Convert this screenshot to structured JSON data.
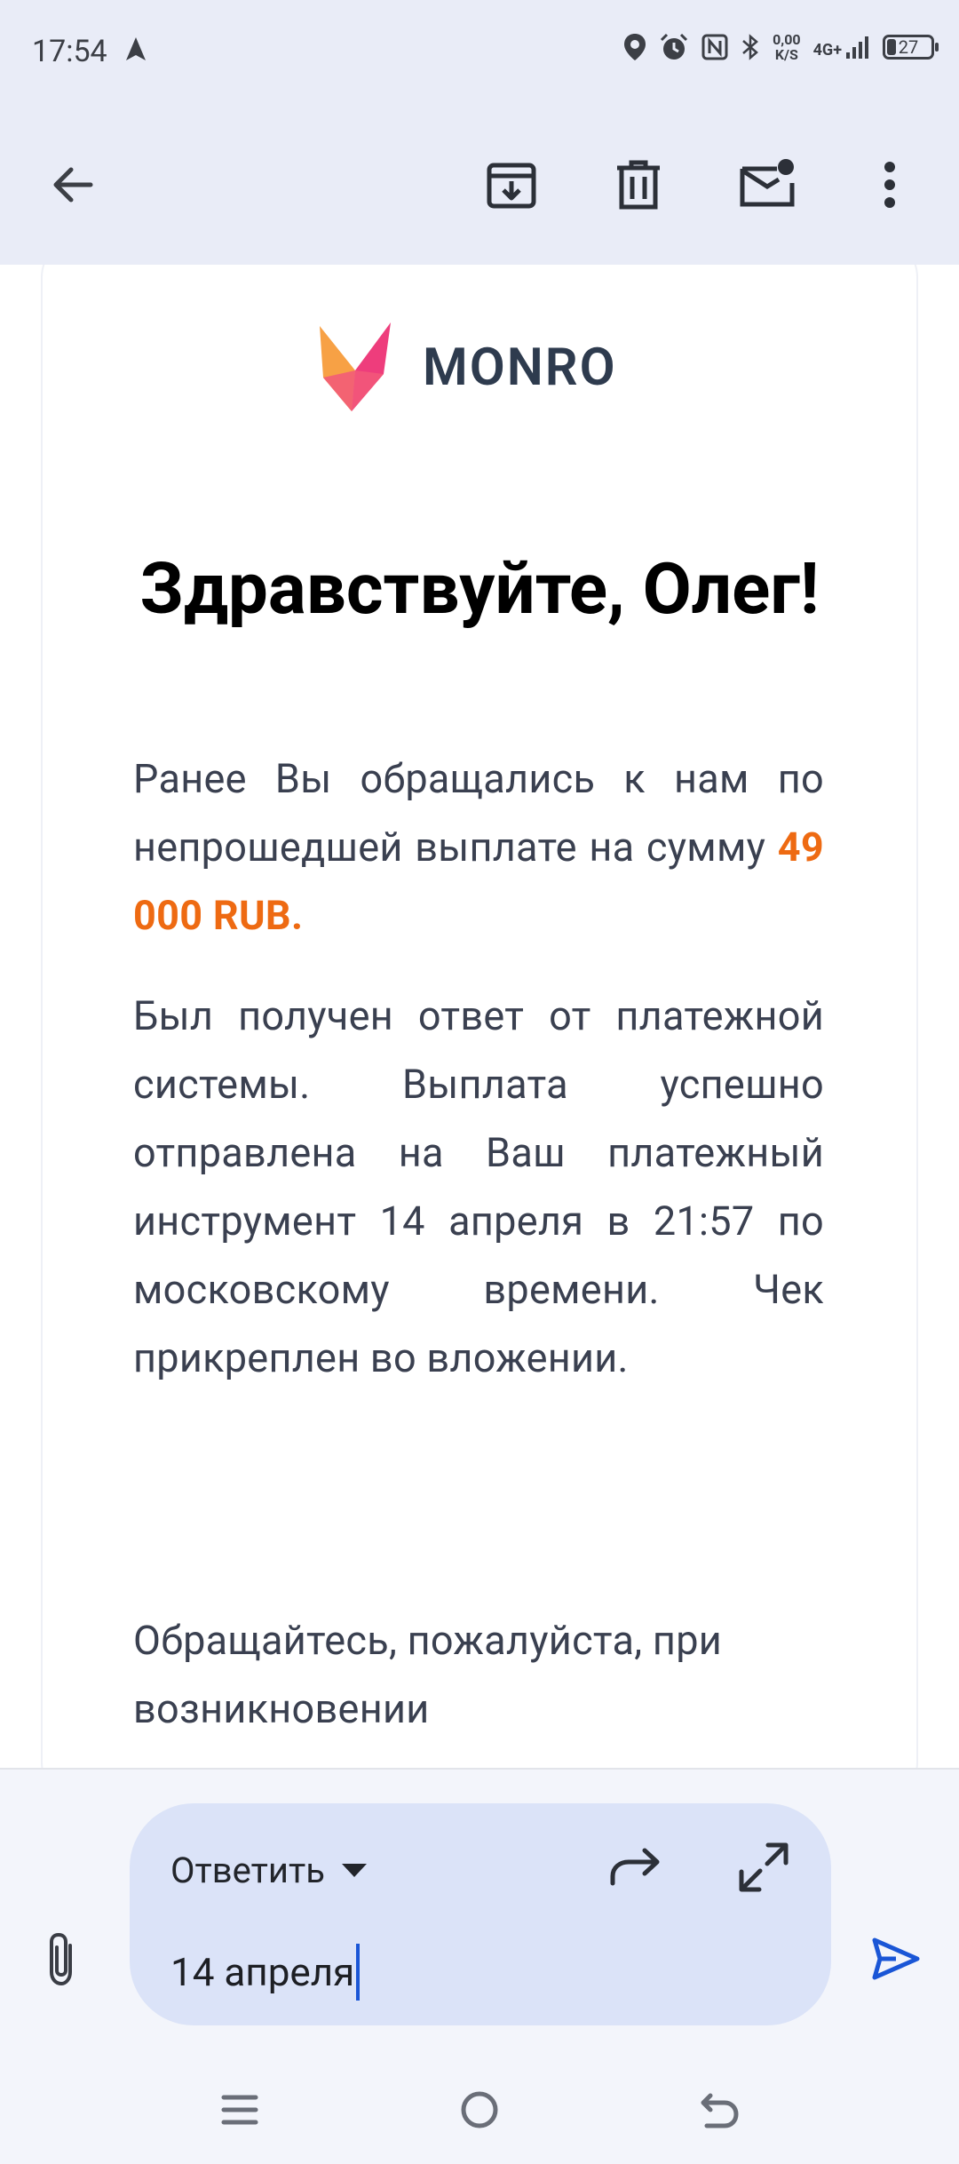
{
  "status_bar": {
    "time": "17:54",
    "speed_value": "0,00",
    "speed_unit": "K/S",
    "network": "4G+",
    "battery": "27"
  },
  "toolbar": {
    "icons": [
      "back-arrow-icon",
      "archive-icon",
      "delete-icon",
      "mark-unread-icon",
      "more-icon"
    ]
  },
  "email": {
    "logo_text": "MONRO",
    "greeting": "Здравствуйте, Олег!",
    "paragraph1_prefix": "Ранее Вы обращались к нам по непрошедшей выплате на сумму",
    "amount": "49 000 RUB.",
    "paragraph2": "Был получен ответ от платежной системы. Выплата успешно отправлена на Ваш платежный инструмент 14 апреля в 21:57 по московскому времени. Чек прикреплен во вложении.",
    "paragraph3": "Обращайтесь, пожалуйста, при возникновении"
  },
  "reply": {
    "mode_label": "Ответить",
    "input_value": "14 апреля"
  },
  "colors": {
    "accent_amount": "#ee6a12",
    "reply_box": "#dbe3f8",
    "send_icon": "#1a56d6",
    "app_bar": "#e9ecf7"
  }
}
